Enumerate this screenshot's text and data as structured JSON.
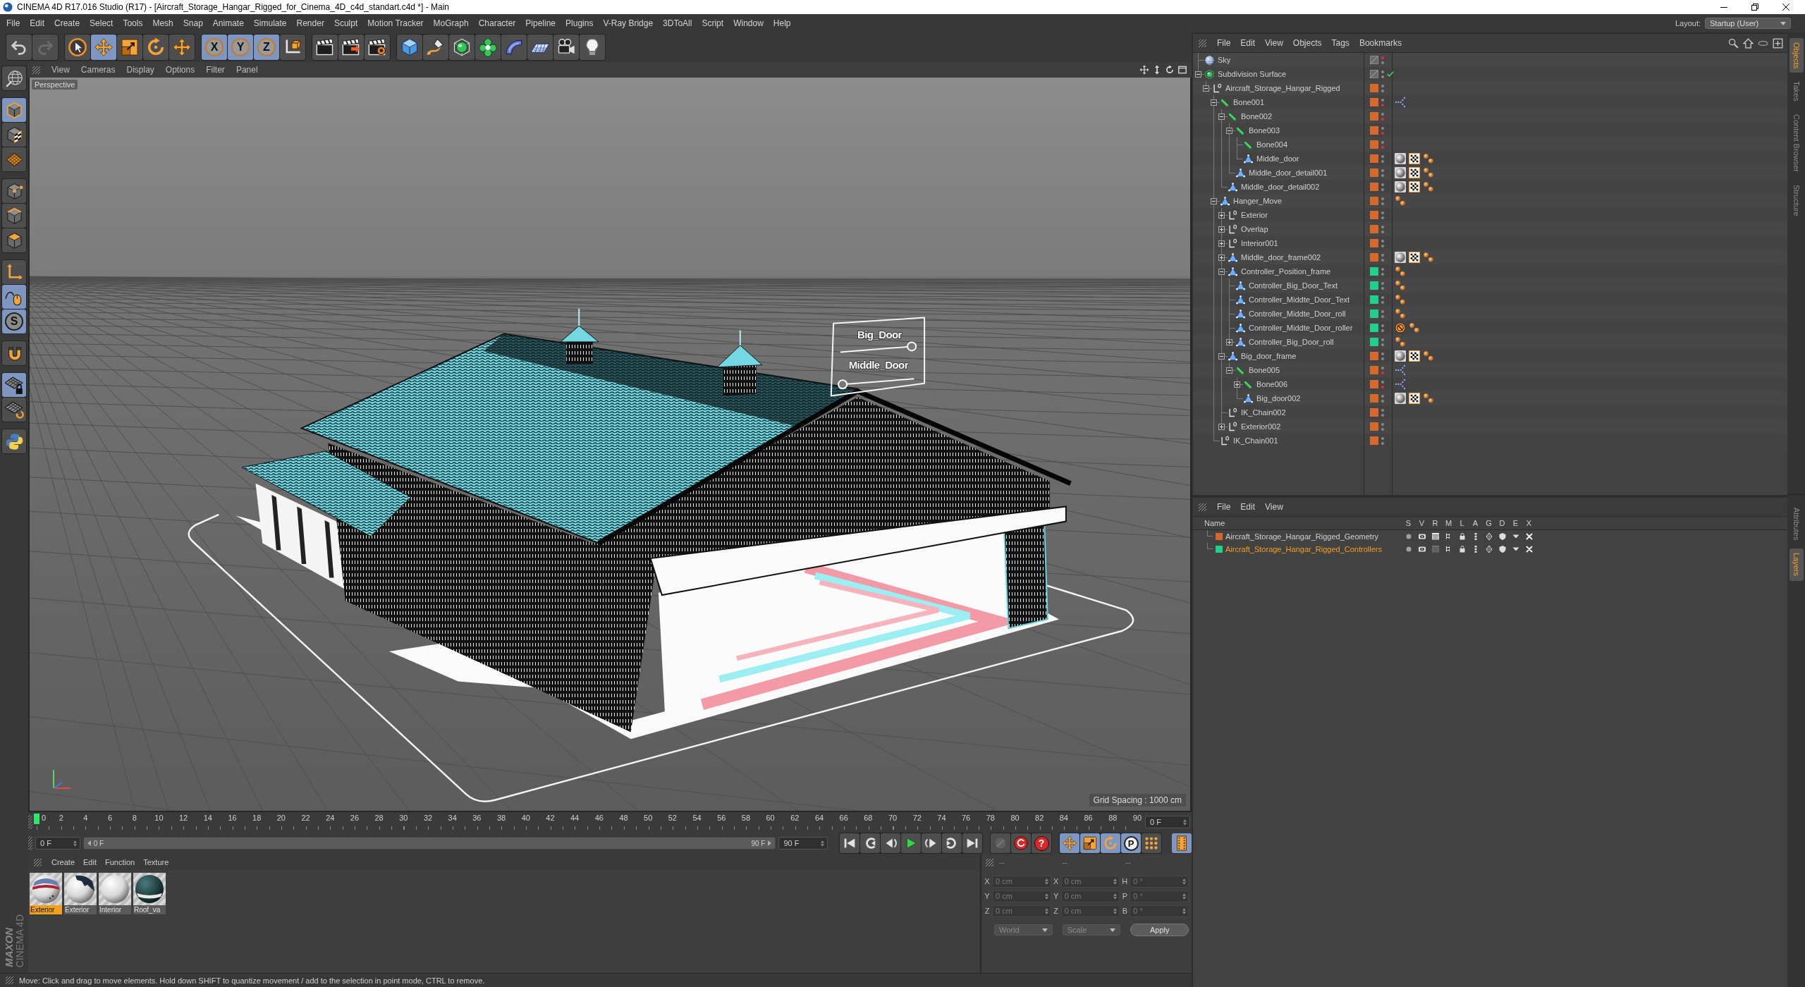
{
  "window": {
    "title": "CINEMA 4D R17.016 Studio (R17) - [Aircraft_Storage_Hangar_Rigged_for_Cinema_4D_c4d_standart.c4d *] - Main"
  },
  "menu": [
    "File",
    "Edit",
    "Create",
    "Select",
    "Tools",
    "Mesh",
    "Snap",
    "Animate",
    "Simulate",
    "Render",
    "Sculpt",
    "Motion Tracker",
    "MoGraph",
    "Character",
    "Pipeline",
    "Plugins",
    "V-Ray Bridge",
    "3DToAll",
    "Script",
    "Window",
    "Help"
  ],
  "layout": {
    "label": "Layout:",
    "value": "Startup (User)"
  },
  "toolbar": [
    [
      {
        "kind": "undo",
        "active": false,
        "disabled": false
      },
      {
        "kind": "redo",
        "active": false,
        "disabled": true
      }
    ],
    [
      {
        "kind": "select",
        "active": false,
        "disabled": false
      },
      {
        "kind": "move",
        "active": true,
        "disabled": false
      },
      {
        "kind": "scale",
        "active": false,
        "disabled": false
      },
      {
        "kind": "rotate",
        "active": false,
        "disabled": false
      },
      {
        "kind": "last_tool",
        "active": false,
        "disabled": false
      }
    ],
    [
      {
        "kind": "axis",
        "label": "X",
        "active": true,
        "disabled": false
      },
      {
        "kind": "axis",
        "label": "Y",
        "active": true,
        "disabled": false
      },
      {
        "kind": "axis",
        "label": "Z",
        "active": true,
        "disabled": false
      },
      {
        "kind": "coord_system",
        "active": false,
        "disabled": false
      }
    ],
    [
      {
        "kind": "render_view",
        "active": false,
        "disabled": false
      },
      {
        "kind": "render_picture",
        "active": false,
        "disabled": false
      },
      {
        "kind": "render_settings",
        "active": false,
        "disabled": false
      }
    ],
    [
      {
        "kind": "cube",
        "active": false,
        "disabled": false
      },
      {
        "kind": "pen",
        "active": false,
        "disabled": false
      },
      {
        "kind": "subdivision",
        "active": false,
        "disabled": false
      },
      {
        "kind": "cloner",
        "active": false,
        "disabled": false
      },
      {
        "kind": "deformer",
        "active": false,
        "disabled": false
      },
      {
        "kind": "floor",
        "active": false,
        "disabled": false
      },
      {
        "kind": "camera",
        "active": false,
        "disabled": false
      },
      {
        "kind": "light",
        "active": false,
        "disabled": false
      }
    ]
  ],
  "left_tools": [
    [
      {
        "kind": "make_editable",
        "active": false
      }
    ],
    [
      {
        "kind": "model",
        "active": true
      },
      {
        "kind": "texture",
        "active": false
      },
      {
        "kind": "workplane",
        "active": false
      }
    ],
    [
      {
        "kind": "points",
        "active": false
      },
      {
        "kind": "edges",
        "active": false
      },
      {
        "kind": "polygons",
        "active": false
      }
    ],
    [
      {
        "kind": "axis_mode",
        "active": false
      },
      {
        "kind": "tweak",
        "active": true
      },
      {
        "kind": "solo",
        "label": "S",
        "active": true
      }
    ],
    [
      {
        "kind": "snap",
        "active": false
      }
    ],
    [
      {
        "kind": "workplane_lock",
        "active": true
      },
      {
        "kind": "workplane_rotate",
        "active": false
      }
    ],
    [
      {
        "kind": "python",
        "active": false
      }
    ]
  ],
  "logo": {
    "brand": "MAXON",
    "product": "CINEMA 4D"
  },
  "viewport": {
    "menu": [
      "View",
      "Cameras",
      "Display",
      "Options",
      "Filter",
      "Panel"
    ],
    "camera": "Perspective",
    "grid_spacing": "Grid Spacing : 1000 cm",
    "controllers": [
      {
        "label": "Big_Door",
        "level": 1
      },
      {
        "label": "Middle_Door",
        "level": 0
      }
    ]
  },
  "timeline": {
    "ticks": [
      "0",
      "2",
      "4",
      "6",
      "8",
      "10",
      "12",
      "14",
      "16",
      "18",
      "20",
      "22",
      "24",
      "26",
      "28",
      "30",
      "32",
      "34",
      "36",
      "38",
      "40",
      "42",
      "44",
      "46",
      "48",
      "50",
      "52",
      "54",
      "56",
      "58",
      "60",
      "62",
      "64",
      "66",
      "68",
      "70",
      "72",
      "74",
      "76",
      "78",
      "80",
      "82",
      "84",
      "86",
      "88",
      "90"
    ],
    "playhead": {
      "level": 0
    },
    "current": "0 F"
  },
  "transport": {
    "start": "0 F",
    "range": {
      "start": "0 F",
      "end": "90 F",
      "level": 1
    },
    "end": "90 F",
    "playback": [
      {
        "kind": "first"
      },
      {
        "kind": "prev_key"
      },
      {
        "kind": "prev_frame"
      },
      {
        "kind": "play"
      },
      {
        "kind": "next_frame"
      },
      {
        "kind": "next_key"
      },
      {
        "kind": "last"
      }
    ],
    "record": [
      {
        "kind": "autokey",
        "disabled": true
      },
      {
        "kind": "record",
        "disabled": false
      },
      {
        "kind": "keyhelp",
        "label": "?",
        "disabled": false
      }
    ],
    "keys": [
      {
        "kind": "key_move",
        "active": true
      },
      {
        "kind": "key_scale",
        "active": true
      },
      {
        "kind": "key_rotate",
        "active": true
      },
      {
        "kind": "key_param",
        "label": "P",
        "active": true
      },
      {
        "kind": "key_pla",
        "active": false
      }
    ],
    "timeline_button": {
      "active": true
    }
  },
  "materials": {
    "menu": [
      "Create",
      "Edit",
      "Function",
      "Texture"
    ],
    "items": [
      {
        "name": "Exterior",
        "kind": "striped",
        "selected": true
      },
      {
        "name": "Exterior",
        "kind": "patched",
        "selected": false
      },
      {
        "name": "Interior",
        "kind": "plain",
        "selected": false
      },
      {
        "name": "Roof_va",
        "kind": "dark",
        "selected": false
      }
    ]
  },
  "coordinates": {
    "headers": [
      "--",
      "--",
      "--"
    ],
    "rows": [
      {
        "label": "X",
        "value": "0 cm",
        "size_label": "X",
        "size": "0 cm",
        "rot_label": "H",
        "rotation": "0 °"
      },
      {
        "label": "Y",
        "value": "0 cm",
        "size_label": "Y",
        "size": "0 cm",
        "rot_label": "P",
        "rotation": "0 °"
      },
      {
        "label": "Z",
        "value": "0 cm",
        "size_label": "Z",
        "size": "0 cm",
        "rot_label": "B",
        "rotation": "0 °"
      }
    ],
    "mode": "World",
    "size_mode": "Scale",
    "apply": "Apply"
  },
  "status_bar": "Move: Click and drag to move elements. Hold down SHIFT to quantize movement / add to the selection in point mode, CTRL to remove.",
  "objects": {
    "menu": [
      "File",
      "Edit",
      "View",
      "Objects",
      "Tags",
      "Bookmarks"
    ],
    "items": [
      {
        "name": "Sky",
        "kind": "sky",
        "hidden_in_editor": true,
        "hidden_in_render": false
      },
      {
        "name": "Subdivision Surface",
        "kind": "subdivision",
        "expanded": true,
        "enabled": true,
        "hidden_in_editor": false,
        "hidden_in_render": false,
        "children": [
          {
            "name": "Aircraft_Storage_Hangar_Rigged",
            "kind": "null",
            "expanded": true,
            "color": "#d4692a",
            "hidden_in_editor": false,
            "hidden_in_render": false,
            "children": [
              {
                "name": "Bone001",
                "kind": "bone",
                "expanded": true,
                "color": "#d4692a",
                "hidden_in_editor": false,
                "hidden_in_render": true,
                "tags": [
                  {
                    "kind": "branch"
                  }
                ],
                "children": [
                  {
                    "name": "Bone002",
                    "kind": "bone",
                    "expanded": true,
                    "color": "#d4692a",
                    "hidden_in_editor": false,
                    "hidden_in_render": true,
                    "children": [
                      {
                        "name": "Bone003",
                        "kind": "bone",
                        "expanded": true,
                        "color": "#d4692a",
                        "hidden_in_editor": false,
                        "hidden_in_render": true,
                        "children": [
                          {
                            "name": "Bone004",
                            "kind": "bone",
                            "color": "#d4692a",
                            "hidden_in_editor": false,
                            "hidden_in_render": true
                          },
                          {
                            "name": "Middle_door",
                            "kind": "polygon",
                            "color": "#d4692a",
                            "hidden_in_editor": false,
                            "hidden_in_render": false,
                            "tags": [
                              {
                                "kind": "material"
                              },
                              {
                                "kind": "texture"
                              },
                              {
                                "kind": "points"
                              }
                            ]
                          }
                        ]
                      },
                      {
                        "name": "Middle_door_detail001",
                        "kind": "polygon",
                        "color": "#d4692a",
                        "hidden_in_editor": false,
                        "hidden_in_render": false,
                        "tags": [
                          {
                            "kind": "material"
                          },
                          {
                            "kind": "texture"
                          },
                          {
                            "kind": "points"
                          }
                        ]
                      }
                    ]
                  },
                  {
                    "name": "Middle_door_detail002",
                    "kind": "polygon",
                    "color": "#d4692a",
                    "hidden_in_editor": false,
                    "hidden_in_render": false,
                    "tags": [
                      {
                        "kind": "material"
                      },
                      {
                        "kind": "texture"
                      },
                      {
                        "kind": "points"
                      }
                    ]
                  }
                ]
              },
              {
                "name": "Hanger_Move",
                "kind": "polygon",
                "expanded": true,
                "color": "#d4692a",
                "hidden_in_editor": false,
                "hidden_in_render": false,
                "tags": [
                  {
                    "kind": "points"
                  }
                ],
                "children": [
                  {
                    "name": "Exterior",
                    "kind": "null",
                    "expanded": false,
                    "color": "#d4692a",
                    "hidden_in_editor": false,
                    "hidden_in_render": false
                  },
                  {
                    "name": "Overlap",
                    "kind": "null",
                    "expanded": false,
                    "color": "#d4692a",
                    "hidden_in_editor": false,
                    "hidden_in_render": false
                  },
                  {
                    "name": "Interior001",
                    "kind": "null",
                    "expanded": false,
                    "color": "#d4692a",
                    "hidden_in_editor": false,
                    "hidden_in_render": false
                  },
                  {
                    "name": "Middle_door_frame002",
                    "kind": "polygon",
                    "expanded": false,
                    "color": "#d4692a",
                    "hidden_in_editor": false,
                    "hidden_in_render": false,
                    "tags": [
                      {
                        "kind": "material"
                      },
                      {
                        "kind": "texture"
                      },
                      {
                        "kind": "points"
                      }
                    ]
                  },
                  {
                    "name": "Controller_Position_frame",
                    "kind": "polygon",
                    "expanded": true,
                    "color": "#22d08e",
                    "hidden_in_editor": false,
                    "hidden_in_render": false,
                    "tags": [
                      {
                        "kind": "points"
                      }
                    ],
                    "children": [
                      {
                        "name": "Controller_Big_Door_Text",
                        "kind": "polygon",
                        "color": "#22d08e",
                        "hidden_in_editor": false,
                        "hidden_in_render": false,
                        "tags": [
                          {
                            "kind": "points"
                          }
                        ]
                      },
                      {
                        "name": "Controller_Middte_Door_Text",
                        "kind": "polygon",
                        "color": "#22d08e",
                        "hidden_in_editor": false,
                        "hidden_in_render": false,
                        "tags": [
                          {
                            "kind": "points"
                          }
                        ]
                      },
                      {
                        "name": "Controller_Middte_Door_roll",
                        "kind": "polygon",
                        "color": "#22d08e",
                        "hidden_in_editor": false,
                        "hidden_in_render": false,
                        "tags": [
                          {
                            "kind": "points"
                          }
                        ]
                      },
                      {
                        "name": "Controller_Middte_Door_roller",
                        "kind": "polygon",
                        "color": "#22d08e",
                        "hidden_in_editor": false,
                        "hidden_in_render": false,
                        "tags": [
                          {
                            "kind": "prohibited"
                          },
                          {
                            "kind": "points"
                          }
                        ]
                      },
                      {
                        "name": "Controller_Big_Door_roll",
                        "kind": "polygon",
                        "expanded": false,
                        "color": "#22d08e",
                        "hidden_in_editor": false,
                        "hidden_in_render": false,
                        "tags": [
                          {
                            "kind": "points"
                          }
                        ]
                      }
                    ]
                  },
                  {
                    "name": "Big_door_frame",
                    "kind": "polygon",
                    "expanded": true,
                    "color": "#d4692a",
                    "hidden_in_editor": false,
                    "hidden_in_render": false,
                    "tags": [
                      {
                        "kind": "material"
                      },
                      {
                        "kind": "texture"
                      },
                      {
                        "kind": "points"
                      }
                    ],
                    "children": [
                      {
                        "name": "Bone005",
                        "kind": "bone",
                        "expanded": true,
                        "color": "#d4692a",
                        "hidden_in_editor": false,
                        "hidden_in_render": true,
                        "tags": [
                          {
                            "kind": "branch"
                          }
                        ],
                        "children": [
                          {
                            "name": "Bone006",
                            "kind": "bone",
                            "expanded": false,
                            "color": "#d4692a",
                            "hidden_in_editor": false,
                            "hidden_in_render": true,
                            "tags": [
                              {
                                "kind": "branch"
                              }
                            ]
                          },
                          {
                            "name": "Big_door002",
                            "kind": "polygon",
                            "color": "#d4692a",
                            "hidden_in_editor": false,
                            "hidden_in_render": false,
                            "tags": [
                              {
                                "kind": "material"
                              },
                              {
                                "kind": "texture"
                              },
                              {
                                "kind": "points"
                              }
                            ]
                          }
                        ]
                      }
                    ]
                  },
                  {
                    "name": "IK_Chain002",
                    "kind": "null",
                    "color": "#d4692a",
                    "hidden_in_editor": false,
                    "hidden_in_render": false
                  },
                  {
                    "name": "Exterior002",
                    "kind": "null",
                    "expanded": false,
                    "color": "#d4692a",
                    "hidden_in_editor": false,
                    "hidden_in_render": false
                  }
                ]
              },
              {
                "name": "IK_Chain001",
                "kind": "null",
                "color": "#d4692a",
                "hidden_in_editor": false,
                "hidden_in_render": false
              }
            ]
          }
        ]
      }
    ]
  },
  "layers": {
    "menu": [
      "File",
      "Edit",
      "View"
    ],
    "columns": [
      "Name",
      "S",
      "V",
      "R",
      "M",
      "L",
      "A",
      "G",
      "D",
      "E",
      "X"
    ],
    "rows": [
      {
        "name": "Aircraft_Storage_Hangar_Rigged_Geometry",
        "color": "#d4692a",
        "selected": false,
        "render": true
      },
      {
        "name": "Aircraft_Storage_Hangar_Rigged_Controllers",
        "color": "#22d08e",
        "selected": true,
        "render": false
      }
    ]
  },
  "side_tabs": {
    "top": [
      {
        "label": "Objects",
        "selected": true
      },
      {
        "label": "Takes",
        "selected": false
      },
      {
        "label": "Content Browser",
        "selected": false
      },
      {
        "label": "Structure",
        "selected": false
      }
    ],
    "bottom": [
      {
        "label": "Attributes",
        "selected": false
      },
      {
        "label": "Layers",
        "selected": true
      }
    ]
  }
}
